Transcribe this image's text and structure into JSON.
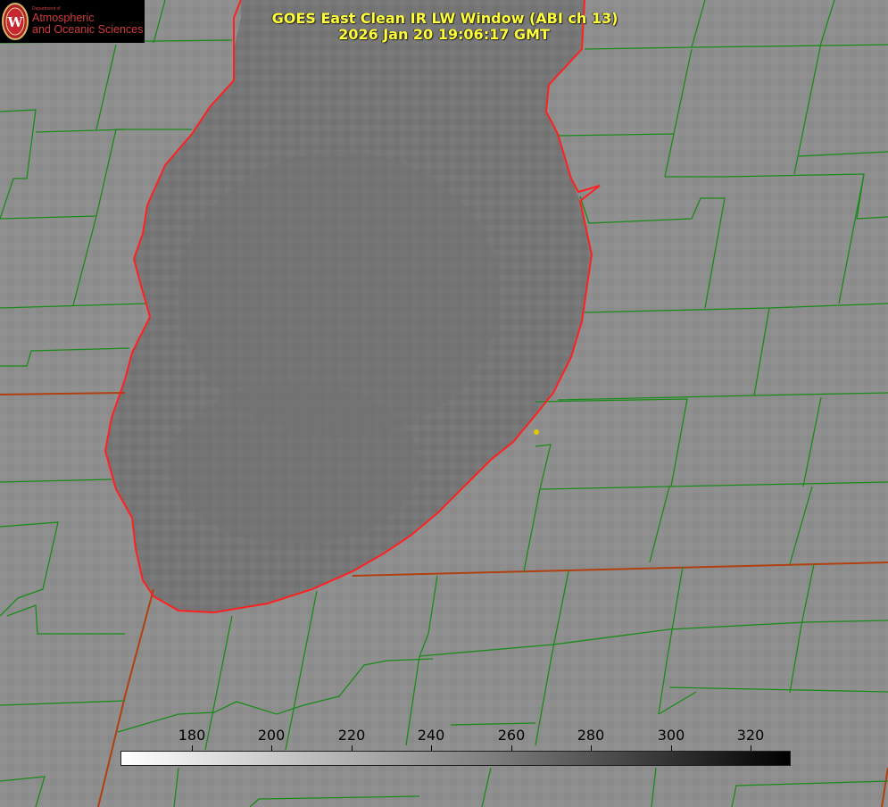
{
  "title": {
    "line1": "GOES East Clean IR LW Window (ABI ch 13)",
    "line2": "2026 Jan 20 19:06:17 GMT"
  },
  "logo": {
    "department": "Department of",
    "line1": "Atmospheric",
    "line2": "and Oceanic Sciences",
    "seal_letter": "W",
    "colors": {
      "background": "#000000",
      "text": "#cf3b3b",
      "seal": "#b0202a"
    }
  },
  "colorbar": {
    "ticks": [
      "180",
      "200",
      "220",
      "240",
      "260",
      "280",
      "300",
      "320"
    ],
    "gradient_start": "#ffffff",
    "gradient_end": "#000000"
  },
  "map": {
    "lake_color": "#777777",
    "land_color": "#8f8f8f",
    "shoreline_color": "#ff2020",
    "county_line_color": "#1a8a1a",
    "state_line_color": "#b04010",
    "marker_color": "#e0c800"
  }
}
